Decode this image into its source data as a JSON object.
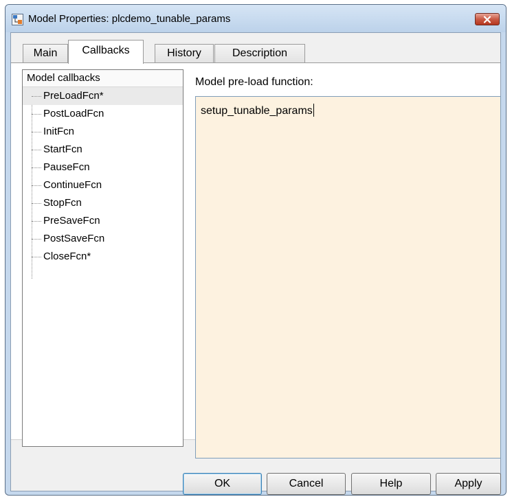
{
  "window": {
    "title": "Model Properties: plcdemo_tunable_params",
    "app_icon": "model-properties-icon",
    "close_icon": "close-x"
  },
  "tabs": [
    {
      "label": "Main",
      "active": false
    },
    {
      "label": "Callbacks",
      "active": true
    },
    {
      "label": "History",
      "active": false
    },
    {
      "label": "Description",
      "active": false
    }
  ],
  "callbacks": {
    "tree_header": "Model callbacks",
    "items": [
      {
        "label": "PreLoadFcn*",
        "selected": true
      },
      {
        "label": "PostLoadFcn",
        "selected": false
      },
      {
        "label": "InitFcn",
        "selected": false
      },
      {
        "label": "StartFcn",
        "selected": false
      },
      {
        "label": "PauseFcn",
        "selected": false
      },
      {
        "label": "ContinueFcn",
        "selected": false
      },
      {
        "label": "StopFcn",
        "selected": false
      },
      {
        "label": "PreSaveFcn",
        "selected": false
      },
      {
        "label": "PostSaveFcn",
        "selected": false
      },
      {
        "label": "CloseFcn*",
        "selected": false
      }
    ],
    "editor_label": "Model pre-load function:",
    "editor_value": "setup_tunable_params"
  },
  "buttons": {
    "ok": "OK",
    "cancel": "Cancel",
    "help": "Help",
    "apply": "Apply"
  },
  "colors": {
    "editor_background": "#fdf2e0",
    "close_button": "#c95a44",
    "window_frame": "#c5d8ed"
  }
}
